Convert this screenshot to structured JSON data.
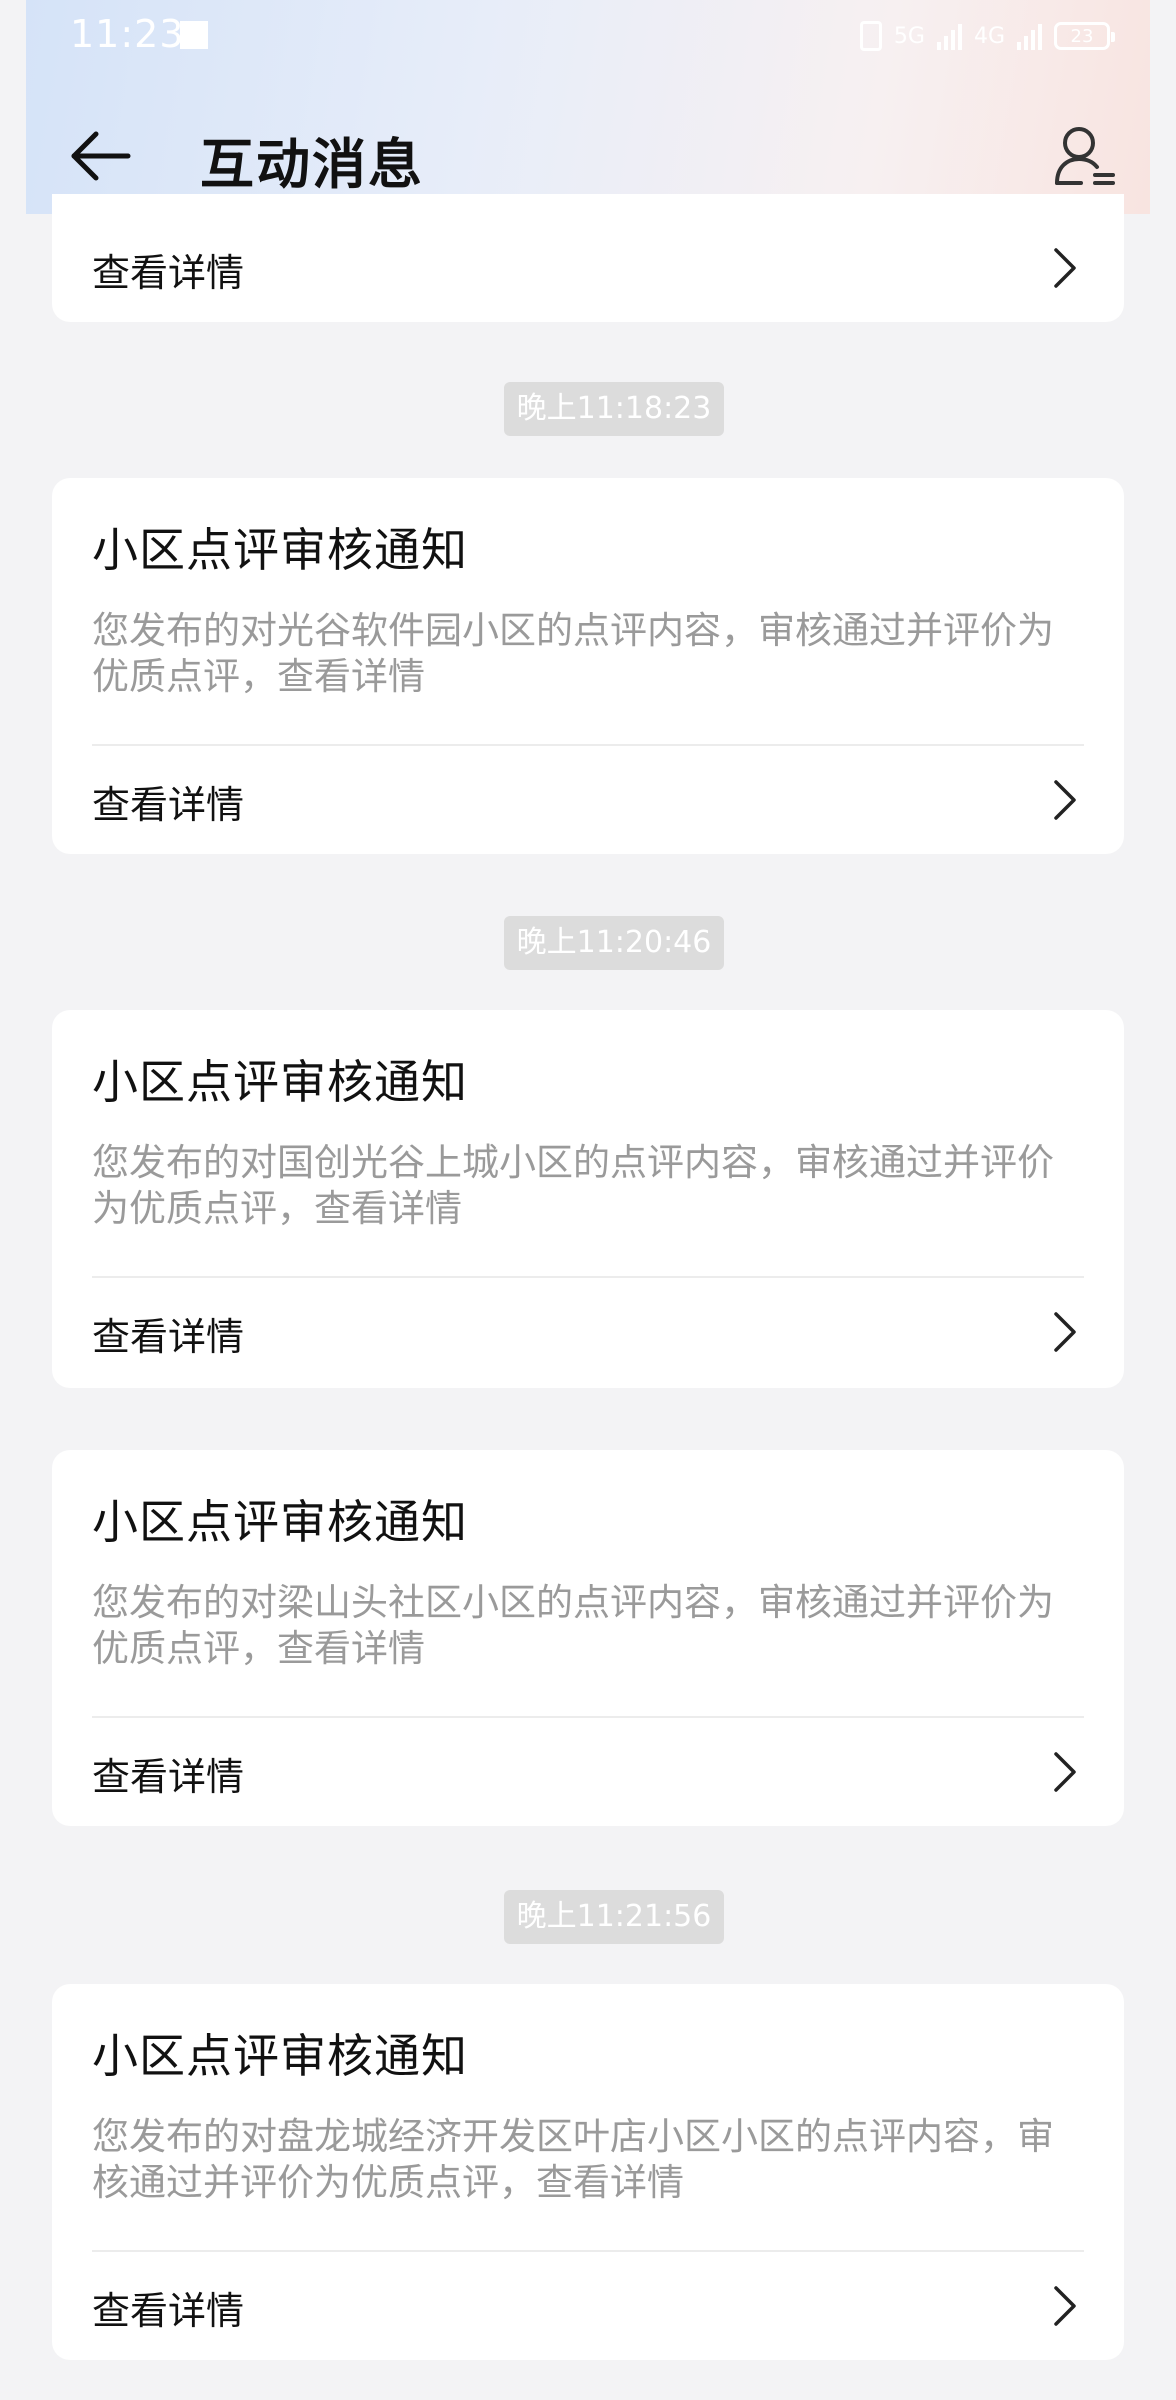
{
  "status_bar": {
    "time": "11:23",
    "battery": "23",
    "signal_5g": "5G",
    "signal_4g": "4G"
  },
  "nav": {
    "title": "互动消息",
    "back_icon": "back-arrow-icon",
    "user_icon": "user-list-icon"
  },
  "detail_label": "查看详情",
  "timestamps": [
    "晚上11:18:23",
    "晚上11:20:46",
    "晚上11:21:56"
  ],
  "cards": [
    {
      "title": "小区点评审核通知",
      "desc": "您发布的对光谷软件园小区的点评内容，审核通过并评价为优质点评，查看详情"
    },
    {
      "title": "小区点评审核通知",
      "desc": "您发布的对国创光谷上城小区的点评内容，审核通过并评价为优质点评，查看详情"
    },
    {
      "title": "小区点评审核通知",
      "desc": "您发布的对梁山头社区小区的点评内容，审核通过并评价为优质点评，查看详情"
    },
    {
      "title": "小区点评审核通知",
      "desc": "您发布的对盘龙城经济开发区叶店小区小区的点评内容，审核通过并评价为优质点评，查看详情"
    }
  ],
  "colors": {
    "background": "#f3f3f5",
    "card": "#ffffff",
    "desc_text": "#9a9a9a",
    "timestamp_badge": "#dcdcdc"
  }
}
